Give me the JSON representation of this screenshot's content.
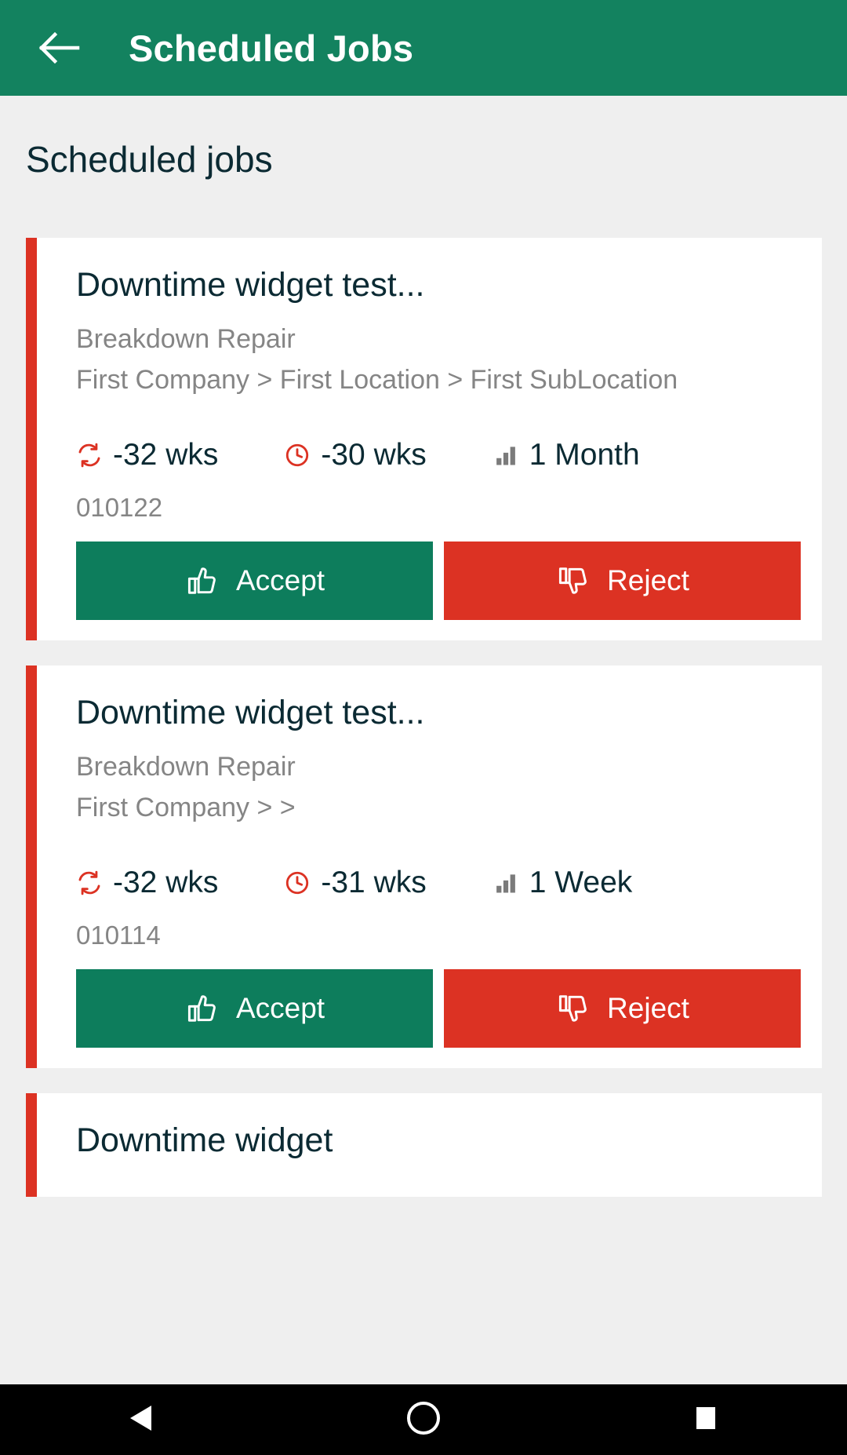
{
  "appbar": {
    "title": "Scheduled Jobs",
    "back_icon": "arrow-left-icon",
    "bg_color": "#13825f"
  },
  "page": {
    "heading": "Scheduled jobs",
    "bg_color": "#efefef",
    "accent_color": "#dc3223"
  },
  "labels": {
    "accept": "Accept",
    "reject": "Reject",
    "accept_icon": "thumbs-up-icon",
    "reject_icon": "thumbs-down-icon",
    "accept_color": "#0d7d5c",
    "reject_color": "#dc3223",
    "repeat_icon": "repeat-sync-icon",
    "clock_icon": "clock-icon",
    "frequency_icon": "bar-chart-icon"
  },
  "jobs": [
    {
      "title": "Downtime widget test...",
      "type": "Breakdown Repair",
      "path": "First Company > First Location > First SubLocation",
      "overdue": "-32 wks",
      "due": "-30 wks",
      "frequency": "1 Month",
      "job_number": "010122"
    },
    {
      "title": "Downtime widget test...",
      "type": "Breakdown Repair",
      "path": "First Company >  >",
      "overdue": "-32 wks",
      "due": "-31 wks",
      "frequency": "1 Week",
      "job_number": "010114"
    },
    {
      "title": "Downtime widget",
      "type": "",
      "path": "",
      "overdue": "",
      "due": "",
      "frequency": "",
      "job_number": ""
    }
  ],
  "navbar": {
    "back": "back-triangle-icon",
    "home": "home-circle-icon",
    "recents": "recents-square-icon"
  }
}
